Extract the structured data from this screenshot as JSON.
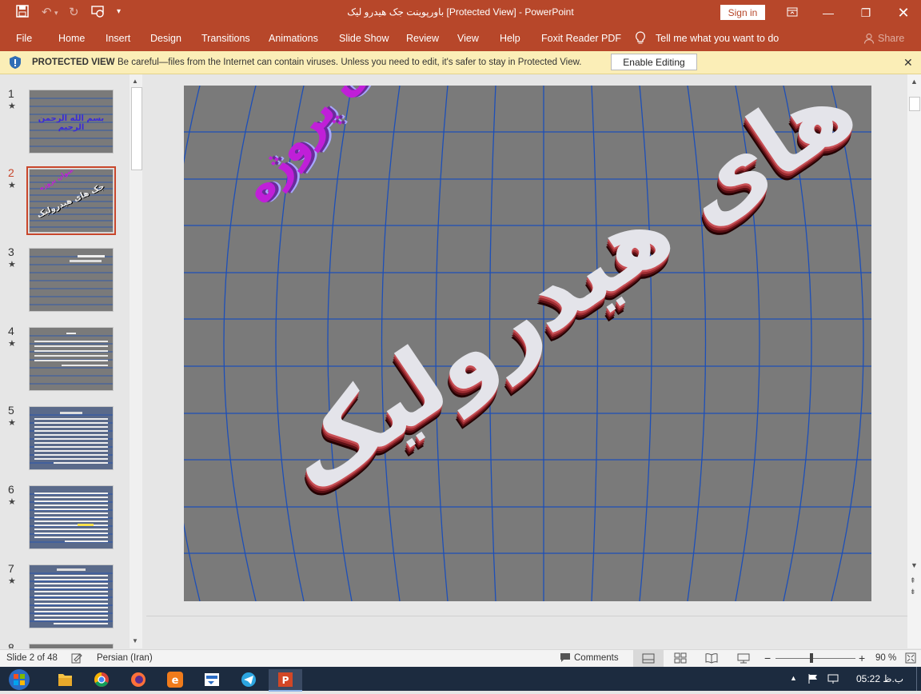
{
  "window": {
    "title": "باورپوینت جک هیدرو لیک [Protected View]  -  PowerPoint",
    "sign_in": "Sign in"
  },
  "ribbon": {
    "tabs": [
      "File",
      "Home",
      "Insert",
      "Design",
      "Transitions",
      "Animations",
      "Slide Show",
      "Review",
      "View",
      "Help",
      "Foxit Reader PDF"
    ],
    "tell_me": "Tell me what you want to do",
    "share": "Share"
  },
  "protected_view": {
    "title": "PROTECTED VIEW",
    "message": "Be careful—files from the Internet can contain viruses. Unless you need to edit, it's safer to stay in Protected View.",
    "enable_button": "Enable Editing"
  },
  "thumbnails": [
    {
      "num": "1",
      "text": "بسم الله الرحمن الرحيم"
    },
    {
      "num": "2",
      "text": "جک های هیدرولیک"
    },
    {
      "num": "3",
      "text": ""
    },
    {
      "num": "4",
      "text": ""
    },
    {
      "num": "5",
      "text": ""
    },
    {
      "num": "6",
      "text": ""
    },
    {
      "num": "7",
      "text": ""
    },
    {
      "num": "8",
      "text": ""
    }
  ],
  "slide": {
    "subtitle": "عنوان پروژه",
    "main_title": "جک های هیدرولیک"
  },
  "status": {
    "slide_of": "Slide 2 of 48",
    "language": "Persian (Iran)",
    "comments": "Comments",
    "zoom": "90 %"
  },
  "taskbar": {
    "clock": "ب.ظ 05:22"
  },
  "colors": {
    "accent": "#b7472a",
    "protected_bar": "#fbeeb7",
    "slide_bg": "#7a7a7a",
    "grid_line": "#1d4fb8",
    "subtitle_fill": "#c01fd8"
  }
}
